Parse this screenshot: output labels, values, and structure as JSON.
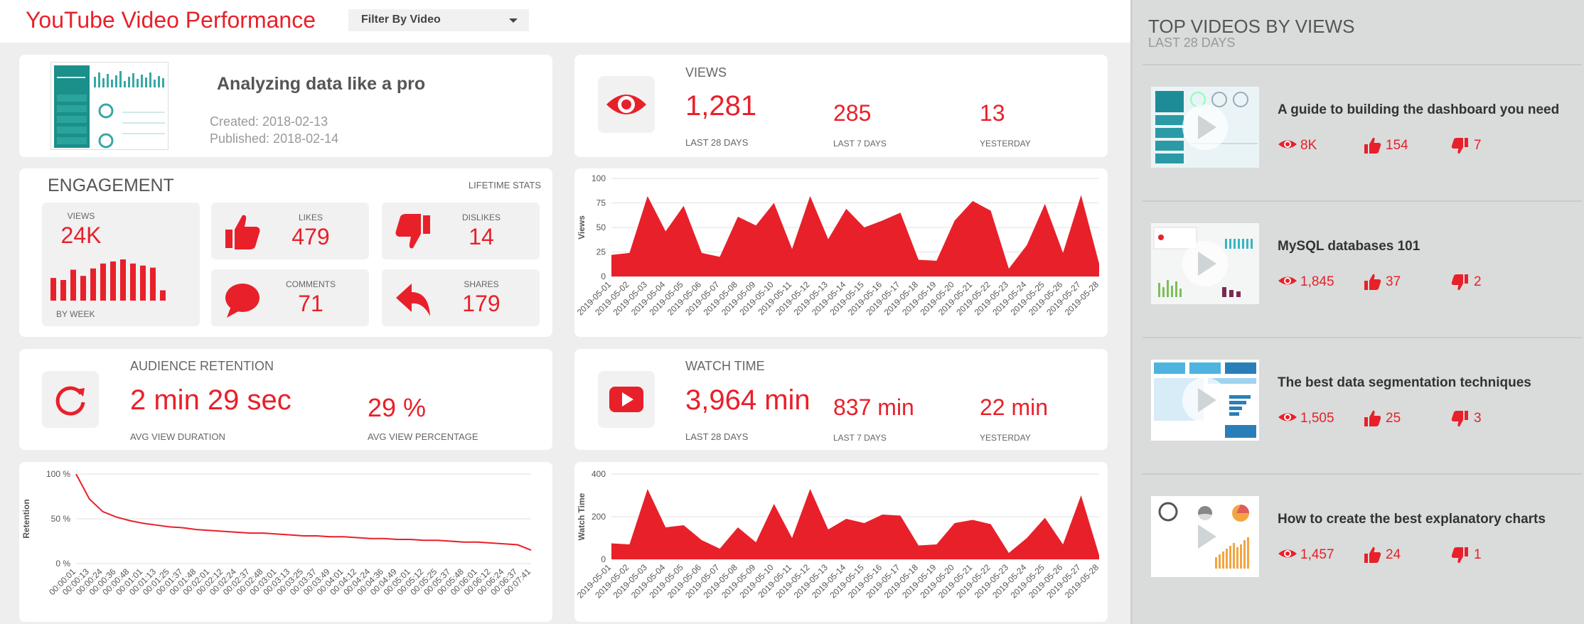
{
  "header": {
    "title": "YouTube Video Performance",
    "filter_label": "Filter By Video"
  },
  "video": {
    "title": "Analyzing data like a pro",
    "created": "Created: 2018-02-13",
    "published": "Published: 2018-02-14"
  },
  "views": {
    "heading": "VIEWS",
    "last28": "1,281",
    "last28_label": "LAST 28 DAYS",
    "last7": "285",
    "last7_label": "LAST 7 DAYS",
    "yesterday": "13",
    "yesterday_label": "YESTERDAY"
  },
  "engagement": {
    "title": "ENGAGEMENT",
    "subtitle": "LIFETIME STATS",
    "views_label": "VIEWS",
    "views_value": "24K",
    "by_week": "BY WEEK",
    "weekly_bars": [
      0.55,
      0.5,
      0.75,
      0.6,
      0.78,
      0.9,
      0.95,
      1.0,
      0.9,
      0.85,
      0.8,
      0.25
    ],
    "likes_label": "LIKES",
    "likes_value": "479",
    "dislikes_label": "DISLIKES",
    "dislikes_value": "14",
    "comments_label": "COMMENTS",
    "comments_value": "71",
    "shares_label": "SHARES",
    "shares_value": "179"
  },
  "retention": {
    "heading": "AUDIENCE RETENTION",
    "avg_duration": "2 min 29 sec",
    "avg_duration_label": "AVG VIEW DURATION",
    "avg_percent": "29 %",
    "avg_percent_label": "AVG VIEW PERCENTAGE"
  },
  "watch": {
    "heading": "WATCH TIME",
    "last28": "3,964 min",
    "last28_label": "LAST 28 DAYS",
    "last7": "837 min",
    "last7_label": "LAST 7 DAYS",
    "yesterday": "22 min",
    "yesterday_label": "YESTERDAY"
  },
  "colors": {
    "accent": "#e8202a",
    "card": "#ffffff",
    "tile": "#f1f1f1",
    "sidebar": "#d9dcdb"
  },
  "chart_data": [
    {
      "type": "area",
      "ylabel": "Views",
      "ylim": [
        0,
        100
      ],
      "yticks": [
        0,
        25,
        50,
        75,
        100
      ],
      "categories": [
        "2019-05-01",
        "2019-05-02",
        "2019-05-03",
        "2019-05-04",
        "2019-05-05",
        "2019-05-06",
        "2019-05-07",
        "2019-05-08",
        "2019-05-09",
        "2019-05-10",
        "2019-05-11",
        "2019-05-12",
        "2019-05-13",
        "2019-05-14",
        "2019-05-15",
        "2019-05-16",
        "2019-05-17",
        "2019-05-18",
        "2019-05-19",
        "2019-05-20",
        "2019-05-21",
        "2019-05-22",
        "2019-05-23",
        "2019-05-24",
        "2019-05-25",
        "2019-05-26",
        "2019-05-27",
        "2019-05-28"
      ],
      "values": [
        22,
        24,
        82,
        46,
        72,
        24,
        20,
        61,
        52,
        75,
        28,
        82,
        38,
        69,
        50,
        57,
        65,
        17,
        16,
        57,
        77,
        67,
        8,
        32,
        74,
        24,
        83,
        13
      ]
    },
    {
      "type": "line",
      "ylabel": "Retention",
      "ylim": [
        0,
        100
      ],
      "yticks": [
        "0 %",
        "50 %",
        "100 %"
      ],
      "categories": [
        "00:00:01",
        "00:00:13",
        "00:00:24",
        "00:00:36",
        "00:00:48",
        "00:01:01",
        "00:01:13",
        "00:01:25",
        "00:01:37",
        "00:01:48",
        "00:02:01",
        "00:02:12",
        "00:02:24",
        "00:02:37",
        "00:02:48",
        "00:03:01",
        "00:03:13",
        "00:03:25",
        "00:03:37",
        "00:03:49",
        "00:04:01",
        "00:04:12",
        "00:04:24",
        "00:04:36",
        "00:04:49",
        "00:05:01",
        "00:05:12",
        "00:05:25",
        "00:05:37",
        "00:05:48",
        "00:06:01",
        "00:06:12",
        "00:06:24",
        "00:06:37",
        "00:07:41"
      ],
      "values": [
        100,
        72,
        58,
        52,
        48,
        45,
        43,
        41,
        40,
        38,
        37,
        36,
        35,
        34,
        34,
        33,
        32,
        31,
        31,
        30,
        30,
        29,
        28,
        28,
        27,
        27,
        26,
        26,
        25,
        24,
        24,
        23,
        22,
        21,
        15
      ]
    },
    {
      "type": "area",
      "ylabel": "Watch Time",
      "ylim": [
        0,
        400
      ],
      "yticks": [
        0,
        200,
        400
      ],
      "categories": [
        "2019-05-01",
        "2019-05-02",
        "2019-05-03",
        "2019-05-04",
        "2019-05-05",
        "2019-05-06",
        "2019-05-07",
        "2019-05-08",
        "2019-05-09",
        "2019-05-10",
        "2019-05-11",
        "2019-05-12",
        "2019-05-13",
        "2019-05-14",
        "2019-05-15",
        "2019-05-16",
        "2019-05-17",
        "2019-05-18",
        "2019-05-19",
        "2019-05-20",
        "2019-05-21",
        "2019-05-22",
        "2019-05-23",
        "2019-05-24",
        "2019-05-25",
        "2019-05-26",
        "2019-05-27",
        "2019-05-28"
      ],
      "values": [
        75,
        70,
        330,
        150,
        160,
        90,
        50,
        150,
        80,
        260,
        100,
        330,
        140,
        190,
        170,
        210,
        205,
        65,
        70,
        170,
        185,
        165,
        30,
        100,
        195,
        70,
        300,
        20
      ]
    }
  ],
  "sidebar": {
    "title": "TOP VIDEOS BY VIEWS",
    "subtitle": "LAST 28 DAYS",
    "videos": [
      {
        "title": "A guide to building the dashboard you need",
        "views": "8K",
        "likes": "154",
        "dislikes": "7"
      },
      {
        "title": "MySQL databases 101",
        "views": "1,845",
        "likes": "37",
        "dislikes": "2"
      },
      {
        "title": "The best data segmentation techniques",
        "views": "1,505",
        "likes": "25",
        "dislikes": "3"
      },
      {
        "title": "How to create the best explanatory charts",
        "views": "1,457",
        "likes": "24",
        "dislikes": "1"
      }
    ]
  }
}
